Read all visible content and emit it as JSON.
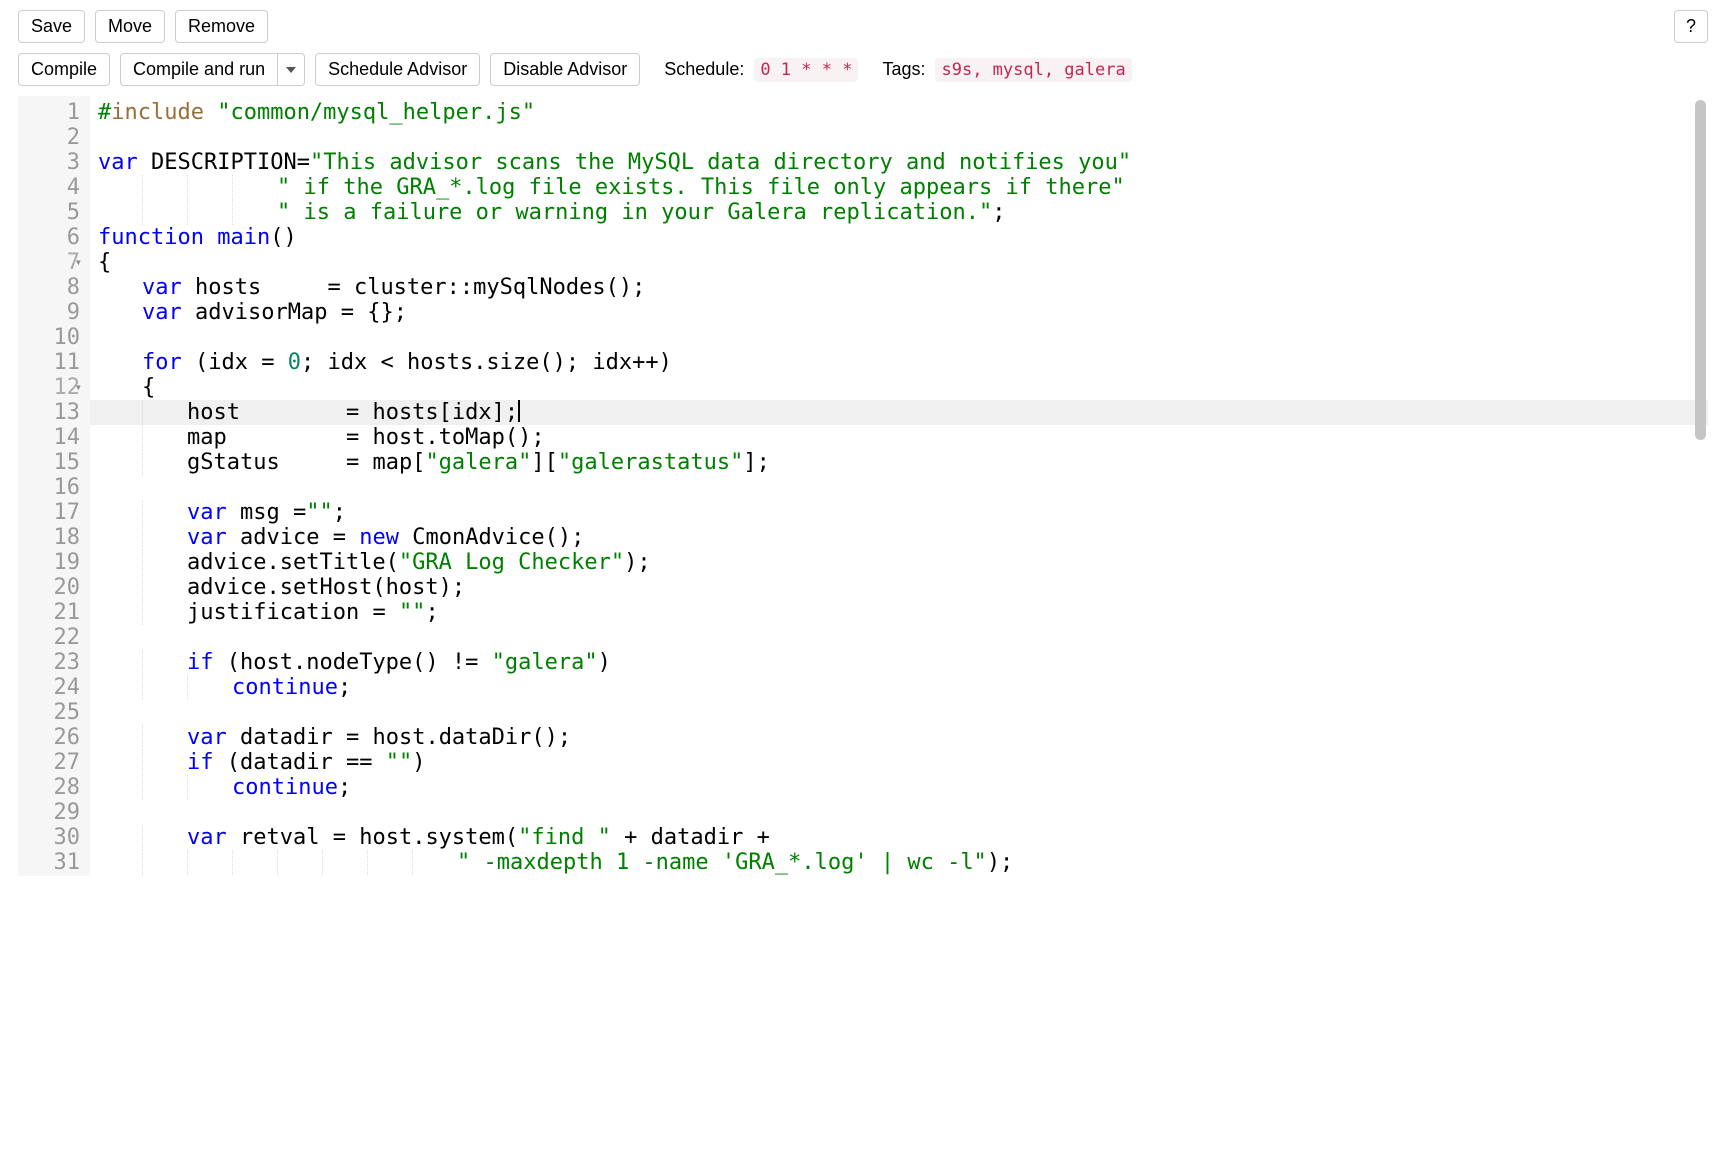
{
  "toolbar1": {
    "save": "Save",
    "move": "Move",
    "remove": "Remove",
    "help": "?"
  },
  "toolbar2": {
    "compile": "Compile",
    "compile_run": "Compile and run",
    "schedule_advisor": "Schedule Advisor",
    "disable_advisor": "Disable Advisor",
    "schedule_label": "Schedule:",
    "schedule_value": "0 1 * * *",
    "tags_label": "Tags:",
    "tags_value": "s9s, mysql, galera"
  },
  "editor": {
    "active_line": 13,
    "line_count": 31,
    "lines": [
      {
        "n": 1,
        "indent": 0,
        "tokens": [
          [
            "pp",
            "#"
          ],
          [
            "inc",
            "include"
          ],
          [
            "pun",
            " "
          ],
          [
            "str",
            "\"common/mysql_helper.js\""
          ]
        ]
      },
      {
        "n": 2,
        "indent": 0,
        "tokens": []
      },
      {
        "n": 3,
        "indent": 0,
        "tokens": [
          [
            "kw",
            "var"
          ],
          [
            "pun",
            " DESCRIPTION"
          ],
          [
            "op",
            "="
          ],
          [
            "str",
            "\"This advisor scans the MySQL data directory and notifies you\""
          ]
        ]
      },
      {
        "n": 4,
        "indent": 4,
        "tokens": [
          [
            "str",
            "\" if the GRA_*.log file exists. This file only appears if there\""
          ]
        ]
      },
      {
        "n": 5,
        "indent": 4,
        "tokens": [
          [
            "str",
            "\" is a failure or warning in your Galera replication.\""
          ],
          [
            "pun",
            ";"
          ]
        ]
      },
      {
        "n": 6,
        "indent": 0,
        "tokens": [
          [
            "kw",
            "function"
          ],
          [
            "pun",
            " "
          ],
          [
            "fn",
            "main"
          ],
          [
            "pun",
            "()"
          ]
        ]
      },
      {
        "n": 7,
        "indent": 0,
        "fold": true,
        "tokens": [
          [
            "pun",
            "{"
          ]
        ]
      },
      {
        "n": 8,
        "indent": 1,
        "tokens": [
          [
            "kw",
            "var"
          ],
          [
            "pun",
            " hosts     "
          ],
          [
            "op",
            "="
          ],
          [
            "pun",
            " cluster"
          ],
          [
            "op",
            "::"
          ],
          [
            "pun",
            "mySqlNodes();"
          ]
        ]
      },
      {
        "n": 9,
        "indent": 1,
        "tokens": [
          [
            "kw",
            "var"
          ],
          [
            "pun",
            " advisorMap "
          ],
          [
            "op",
            "="
          ],
          [
            "pun",
            " {};"
          ]
        ]
      },
      {
        "n": 10,
        "indent": 0,
        "tokens": []
      },
      {
        "n": 11,
        "indent": 1,
        "tokens": [
          [
            "kw",
            "for"
          ],
          [
            "pun",
            " (idx "
          ],
          [
            "op",
            "="
          ],
          [
            "pun",
            " "
          ],
          [
            "num",
            "0"
          ],
          [
            "pun",
            "; idx "
          ],
          [
            "op",
            "<"
          ],
          [
            "pun",
            " hosts.size(); idx"
          ],
          [
            "op",
            "++"
          ],
          [
            "pun",
            ")"
          ]
        ]
      },
      {
        "n": 12,
        "indent": 1,
        "fold": true,
        "tokens": [
          [
            "pun",
            "{"
          ]
        ]
      },
      {
        "n": 13,
        "indent": 2,
        "tokens": [
          [
            "pun",
            "host        "
          ],
          [
            "op",
            "="
          ],
          [
            "pun",
            " hosts[idx];"
          ],
          [
            "cursor",
            ""
          ]
        ]
      },
      {
        "n": 14,
        "indent": 2,
        "tokens": [
          [
            "pun",
            "map         "
          ],
          [
            "op",
            "="
          ],
          [
            "pun",
            " host.toMap();"
          ]
        ]
      },
      {
        "n": 15,
        "indent": 2,
        "tokens": [
          [
            "pun",
            "gStatus     "
          ],
          [
            "op",
            "="
          ],
          [
            "pun",
            " map["
          ],
          [
            "str",
            "\"galera\""
          ],
          [
            "pun",
            "]["
          ],
          [
            "str",
            "\"galerastatus\""
          ],
          [
            "pun",
            "];"
          ]
        ]
      },
      {
        "n": 16,
        "indent": 0,
        "tokens": []
      },
      {
        "n": 17,
        "indent": 2,
        "tokens": [
          [
            "kw",
            "var"
          ],
          [
            "pun",
            " msg "
          ],
          [
            "op",
            "="
          ],
          [
            "str",
            "\"\""
          ],
          [
            "pun",
            ";"
          ]
        ]
      },
      {
        "n": 18,
        "indent": 2,
        "tokens": [
          [
            "kw",
            "var"
          ],
          [
            "pun",
            " advice "
          ],
          [
            "op",
            "="
          ],
          [
            "pun",
            " "
          ],
          [
            "kw",
            "new"
          ],
          [
            "pun",
            " CmonAdvice();"
          ]
        ]
      },
      {
        "n": 19,
        "indent": 2,
        "tokens": [
          [
            "pun",
            "advice.setTitle("
          ],
          [
            "str",
            "\"GRA Log Checker\""
          ],
          [
            "pun",
            ");"
          ]
        ]
      },
      {
        "n": 20,
        "indent": 2,
        "tokens": [
          [
            "pun",
            "advice.setHost(host);"
          ]
        ]
      },
      {
        "n": 21,
        "indent": 2,
        "tokens": [
          [
            "pun",
            "justification "
          ],
          [
            "op",
            "="
          ],
          [
            "pun",
            " "
          ],
          [
            "str",
            "\"\""
          ],
          [
            "pun",
            ";"
          ]
        ]
      },
      {
        "n": 22,
        "indent": 0,
        "tokens": []
      },
      {
        "n": 23,
        "indent": 2,
        "tokens": [
          [
            "kw",
            "if"
          ],
          [
            "pun",
            " (host.nodeType() "
          ],
          [
            "op",
            "!="
          ],
          [
            "pun",
            " "
          ],
          [
            "str",
            "\"galera\""
          ],
          [
            "pun",
            ")"
          ]
        ]
      },
      {
        "n": 24,
        "indent": 3,
        "tokens": [
          [
            "kw",
            "continue"
          ],
          [
            "pun",
            ";"
          ]
        ]
      },
      {
        "n": 25,
        "indent": 0,
        "tokens": []
      },
      {
        "n": 26,
        "indent": 2,
        "tokens": [
          [
            "kw",
            "var"
          ],
          [
            "pun",
            " datadir "
          ],
          [
            "op",
            "="
          ],
          [
            "pun",
            " host.dataDir();"
          ]
        ]
      },
      {
        "n": 27,
        "indent": 2,
        "tokens": [
          [
            "kw",
            "if"
          ],
          [
            "pun",
            " (datadir "
          ],
          [
            "op",
            "=="
          ],
          [
            "pun",
            " "
          ],
          [
            "str",
            "\"\""
          ],
          [
            "pun",
            ")"
          ]
        ]
      },
      {
        "n": 28,
        "indent": 3,
        "tokens": [
          [
            "kw",
            "continue"
          ],
          [
            "pun",
            ";"
          ]
        ]
      },
      {
        "n": 29,
        "indent": 0,
        "tokens": []
      },
      {
        "n": 30,
        "indent": 2,
        "tokens": [
          [
            "kw",
            "var"
          ],
          [
            "pun",
            " retval "
          ],
          [
            "op",
            "="
          ],
          [
            "pun",
            " host.system("
          ],
          [
            "str",
            "\"find \""
          ],
          [
            "pun",
            " "
          ],
          [
            "op",
            "+"
          ],
          [
            "pun",
            " datadir "
          ],
          [
            "op",
            "+"
          ]
        ]
      },
      {
        "n": 31,
        "indent": 8,
        "tokens": [
          [
            "str",
            "\" -maxdepth 1 -name 'GRA_*.log' | wc -l\""
          ],
          [
            "pun",
            ");"
          ]
        ]
      }
    ]
  }
}
